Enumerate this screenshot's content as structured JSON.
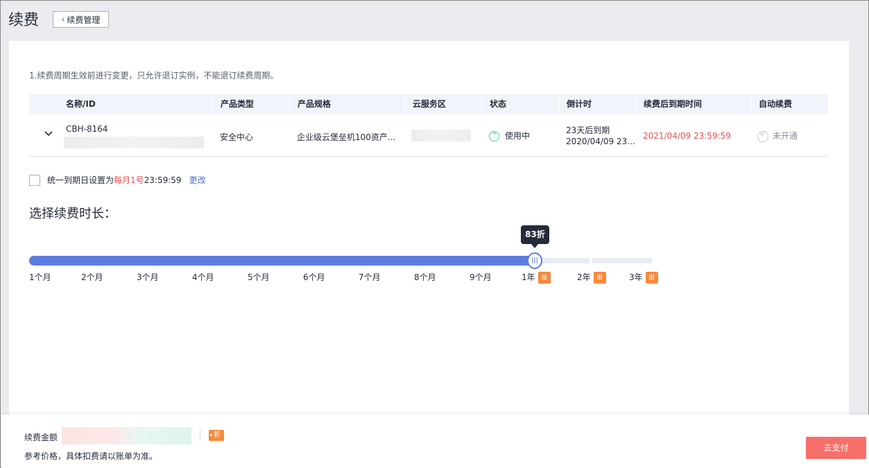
{
  "page": {
    "title": "续费",
    "back_label": "续费管理"
  },
  "notice": "1.续费周期生效前进行变更，只允许退订实例，不能退订续费周期。",
  "table": {
    "headers": [
      "名称/ID",
      "产品类型",
      "产品规格",
      "云服务区",
      "状态",
      "倒计时",
      "续费后到期时间",
      "自动续费"
    ],
    "row": {
      "name": "CBH-8164",
      "product_type": "安全中心",
      "spec": "企业级云堡垒机100资产...",
      "status": "使用中",
      "countdown_line1": "23天后到期",
      "countdown_line2": "2020/04/09 23...",
      "expire_after": "2021/04/09 23:59:59",
      "auto_renew": "未开通"
    }
  },
  "unify": {
    "prefix": "统一到期日设置为",
    "highlight": "每月1号",
    "suffix": "23:59:59",
    "change_link": "更改"
  },
  "duration": {
    "title": "选择续费时长：",
    "tooltip": "83折",
    "selected": "1年",
    "options": [
      "1个月",
      "2个月",
      "3个月",
      "4个月",
      "5个月",
      "6个月",
      "7个月",
      "8个月",
      "9个月",
      "1年",
      "2年",
      "3年"
    ],
    "gift_icon": "gift-icon"
  },
  "footer": {
    "fee_label": "续费金额",
    "discount_tag": "折",
    "ref_note": "参考价格，具体扣费请以账单为准。",
    "pay_button": "去支付"
  },
  "colors": {
    "accent": "#5e7ce0",
    "danger": "#e84e4f",
    "pay": "#f66f6a",
    "gift": "#f58a3c",
    "status_ok": "#4fcfa8"
  }
}
